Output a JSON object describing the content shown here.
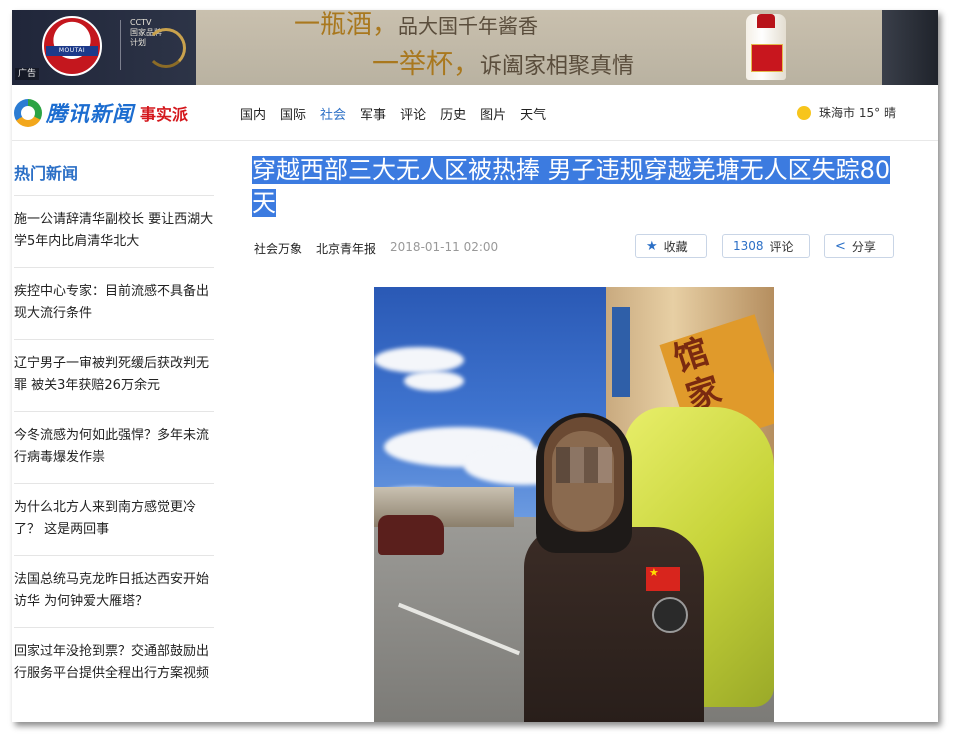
{
  "ad": {
    "line1": "一瓶酒，",
    "line1_sub": "品大国千年酱香",
    "line2": "一举杯，",
    "line2_sub": "诉阖家相聚真情",
    "brand": "MOUTAI",
    "cctv_line1": "CCTV",
    "cctv_line2": "国家品牌",
    "cctv_line3": "计划",
    "badge": "广告"
  },
  "header": {
    "logo_text": "腾讯新闻",
    "logo_sub": "事实派",
    "nav": [
      "国内",
      "国际",
      "社会",
      "军事",
      "评论",
      "历史",
      "图片",
      "天气"
    ],
    "active_nav": "社会",
    "weather": {
      "city": "珠海市",
      "temp": "15°",
      "condition": "晴"
    }
  },
  "sidebar": {
    "title": "热门新闻",
    "items": [
      "施一公请辞清华副校长 要让西湖大学5年内比肩清华北大",
      "疾控中心专家：目前流感不具备出现大流行条件",
      "辽宁男子一审被判死缓后获改判无罪 被关3年获赔26万余元",
      "今冬流感为何如此强悍？多年未流行病毒爆发作祟",
      "为什么北方人来到南方感觉更冷了？ 这是两回事",
      "法国总统马克龙昨日抵达西安开始访华 为何钟爱大雁塔？",
      "回家过年没抢到票？交通部鼓励出行服务平台提供全程出行方案视频"
    ]
  },
  "article": {
    "title": "穿越西部三大无人区被热捧 男子违规穿越羌塘无人区失踪80天",
    "category": "社会万象",
    "source": "北京青年报",
    "time": "2018-01-11 02:00",
    "favorite_label": "收藏",
    "comment_count": "1308",
    "comment_label": "评论",
    "share_label": "分享"
  },
  "colors": {
    "accent": "#2b6fc6",
    "title_highlight": "#3c7be0",
    "brand_red": "#d4171c"
  }
}
